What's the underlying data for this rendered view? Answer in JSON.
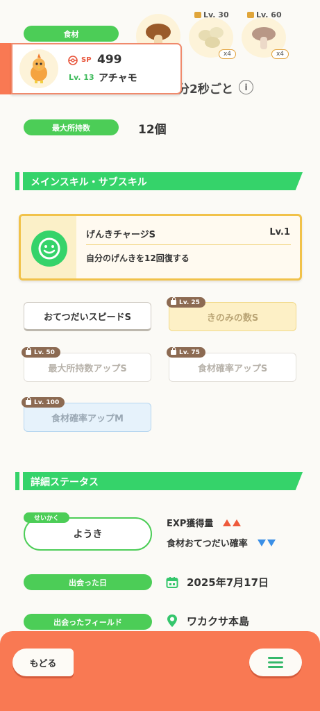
{
  "top": {
    "ingredient_label": "食材",
    "lv30_label": "Lv. 30",
    "lv60_label": "Lv. 60",
    "lv30_count": "x4",
    "lv60_count": "x4"
  },
  "profile": {
    "sp_label": "SP",
    "sp_value": "499",
    "level": "Lv. 13",
    "name": "アチャモ"
  },
  "help_interval_text": "分2秒ごと",
  "max_carry": {
    "label": "最大所持数",
    "value": "12個"
  },
  "skills_section_title": "メインスキル・サブスキル",
  "main_skill": {
    "name": "げんきチャージS",
    "level": "Lv.1",
    "description": "自分のげんきを12回復する"
  },
  "sub_skills": [
    {
      "name": "おてつだいスピードS",
      "lock_level": ""
    },
    {
      "name": "きのみの数S",
      "lock_level": "Lv. 25"
    },
    {
      "name": "最大所持数アップS",
      "lock_level": "Lv. 50"
    },
    {
      "name": "食材確率アップS",
      "lock_level": "Lv. 75"
    },
    {
      "name": "食材確率アップM",
      "lock_level": "Lv. 100"
    }
  ],
  "details_section_title": "詳細ステータス",
  "nature": {
    "tag": "せいかく",
    "value": "ようき",
    "up_stat": "EXP獲得量",
    "down_stat": "食材おてつだい確率"
  },
  "met_date": {
    "label": "出会った日",
    "value": "2025年7月17日"
  },
  "met_field": {
    "label": "出会ったフィールド",
    "value": "ワカクサ本島"
  },
  "footer": {
    "back_label": "もどる"
  },
  "colors": {
    "accent_green": "#35d36a",
    "footer_orange": "#f97953",
    "gold": "#f1c24a"
  }
}
